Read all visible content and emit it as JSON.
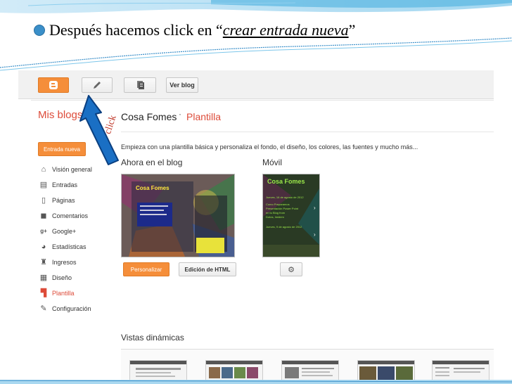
{
  "slide": {
    "title_pre": "Después hacemos click en “",
    "title_link": "crear entrada nueva",
    "title_post": "”",
    "click_label": "click"
  },
  "toolbar": {
    "view_blog": "Ver blog"
  },
  "header": {
    "my_blogs": "Mis blogs",
    "blog_name": "Cosa Fomes",
    "separator": "·",
    "section": "Plantilla"
  },
  "intro": "Empieza con una plantilla básica y personaliza el fondo, el diseño, los colores, las fuentes y mucho más...",
  "sidebar": {
    "new_post": "Entrada nueva",
    "items": [
      {
        "label": "Visión general",
        "icon": "home-icon"
      },
      {
        "label": "Entradas",
        "icon": "posts-icon"
      },
      {
        "label": "Páginas",
        "icon": "pages-icon"
      },
      {
        "label": "Comentarios",
        "icon": "comments-icon"
      },
      {
        "label": "Google+",
        "icon": "google-plus-icon"
      },
      {
        "label": "Estadísticas",
        "icon": "stats-icon"
      },
      {
        "label": "Ingresos",
        "icon": "earnings-icon"
      },
      {
        "label": "Diseño",
        "icon": "layout-icon"
      },
      {
        "label": "Plantilla",
        "icon": "template-icon"
      },
      {
        "label": "Configuración",
        "icon": "settings-icon"
      }
    ],
    "active_index": 8
  },
  "template": {
    "now_title": "Ahora en el blog",
    "mobile_title": "Móvil",
    "customize": "Personalizar",
    "edit_html": "Edición de HTML",
    "dynamic_title": "Vistas dinámicas",
    "thumb_blog_title": "Cosa Fomes",
    "thumb_mobile_title": "Cosa Fomes",
    "mobile_posts": [
      "Jueves, 16 de agosto de 2012",
      "Como Preparamos",
      "Presentación Power Point",
      "en tu Blog from",
      "Dotos, Imidem",
      "Jueves, 9 de agosto de 2012"
    ]
  },
  "colors": {
    "accent": "#f58e3a",
    "link_red": "#dd4b39",
    "arrow_blue": "#1a6fc4",
    "bullet_blue": "#3a8fc9"
  }
}
